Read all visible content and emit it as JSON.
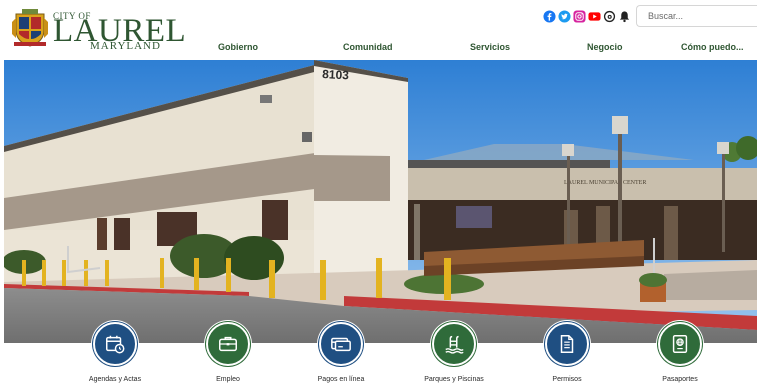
{
  "colors": {
    "brand_green": "#2f5632",
    "quick_blue": "#1f4f82",
    "quick_green": "#2f6b3a"
  },
  "logo": {
    "city_of": "CITY OF",
    "name": "LAUREL",
    "state": "MARYLAND",
    "seal_icon": "city-seal-icon"
  },
  "social": [
    {
      "name": "facebook-icon",
      "color": "#1877f2"
    },
    {
      "name": "twitter-icon",
      "color": "#1d9bf0"
    },
    {
      "name": "instagram-icon",
      "color": "#d6249f"
    },
    {
      "name": "youtube-icon",
      "color": "#ff0000"
    },
    {
      "name": "threads-icon",
      "color": "#222222"
    },
    {
      "name": "alerts-bell-icon",
      "color": "#222222"
    }
  ],
  "search": {
    "placeholder": "Buscar..."
  },
  "nav": [
    {
      "label": "Gobierno"
    },
    {
      "label": "Comunidad"
    },
    {
      "label": "Servicios"
    },
    {
      "label": "Negocio"
    },
    {
      "label": "Cómo puedo..."
    }
  ],
  "hero": {
    "building_number": "8103",
    "sign_text": "LAUREL MUNICIPAL CENTER"
  },
  "quick_links": [
    {
      "label": "Agendas y Actas",
      "icon": "calendar-clock-icon",
      "color": "#1f4f82"
    },
    {
      "label": "Empleo",
      "icon": "briefcase-icon",
      "color": "#2f6b3a"
    },
    {
      "label": "Pagos en línea",
      "icon": "credit-card-icon",
      "color": "#1f4f82"
    },
    {
      "label": "Parques y Piscinas",
      "icon": "pool-ladder-icon",
      "color": "#2f6b3a"
    },
    {
      "label": "Permisos",
      "icon": "permit-document-icon",
      "color": "#1f4f82"
    },
    {
      "label": "Pasaportes",
      "icon": "passport-icon",
      "color": "#2f6b3a"
    }
  ]
}
